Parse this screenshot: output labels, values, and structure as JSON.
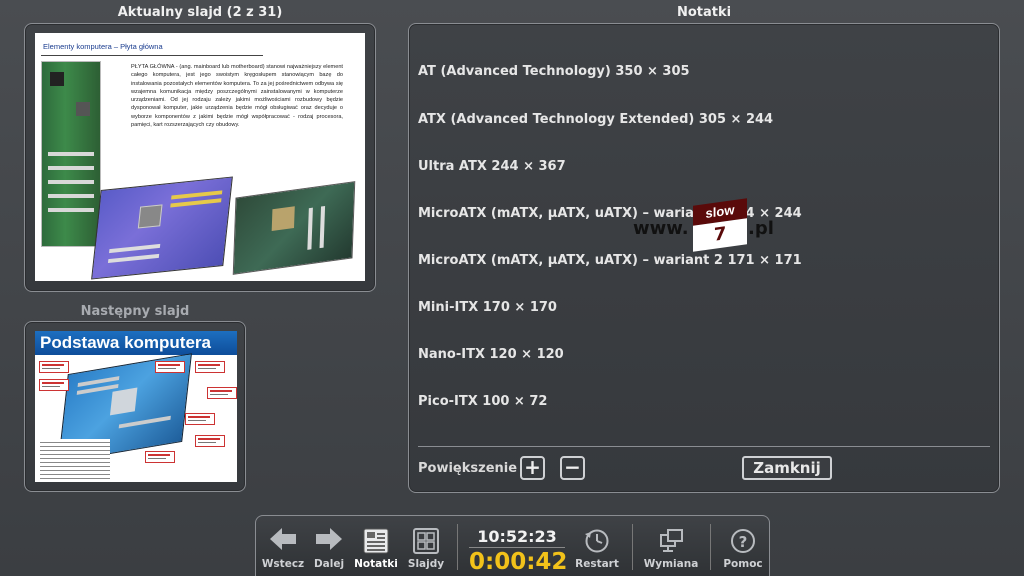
{
  "current_slide": {
    "heading": "Aktualny slajd (2 z 31)",
    "title": "Elementy komputera – Płyta główna",
    "body": "PŁYTA GŁÓWNA - (ang. mainboard lub motherboard) stanowi najważniejszy element całego komputera, jest jego swoistym kręgosłupem stanowiącym bazę do instalowania pozostałych elementów komputera. To za jej pośrednictwem odbywa się wzajemna komunikacja między poszczególnymi zainstalowanymi w komputerze urządzeniami. Od jej rodzaju zależy jakimi możliwościami rozbudowy będzie dysponował komputer, jakie urządzenia będzie mógł obsługiwać oraz decyduje o wyborze komponentów z jakimi będzie mógł współpracować - rodzaj procesora, pamięci, kart rozszerzających czy obudowy."
  },
  "next_slide": {
    "heading": "Następny slajd",
    "title": "Podstawa komputera"
  },
  "notes": {
    "heading": "Notatki",
    "lines": [
      "AT (Advanced Technology) 350 × 305",
      "ATX (Advanced Technology Extended) 305 × 244",
      "Ultra ATX 244 × 367",
      "MicroATX (mATX, μATX, uATX) – wariant 1 244 × 244",
      "MicroATX (mATX, μATX, uATX) – wariant 2 171 × 171",
      "Mini-ITX 170 × 170",
      "Nano-ITX 120 × 120",
      "Pico-ITX 100 × 72"
    ],
    "logo": {
      "prefix": "www.",
      "box_top": "slow",
      "box_bottom": "7",
      "suffix": ".pl"
    },
    "zoom_label": "Powiększenie",
    "zoom_plus": "+",
    "zoom_minus": "−",
    "close_label": "Zamknij"
  },
  "toolbar": {
    "back_label": "Wstecz",
    "forward_label": "Dalej",
    "notes_label": "Notatki",
    "slides_label": "Slajdy",
    "clock": "10:52:23",
    "timer": "0:00:42",
    "restart_label": "Restart",
    "swap_label": "Wymiana",
    "help_label": "Pomoc"
  },
  "colors": {
    "background": "#44474b",
    "timer": "#f2c21a",
    "logo_dark": "#5a0a0a"
  }
}
